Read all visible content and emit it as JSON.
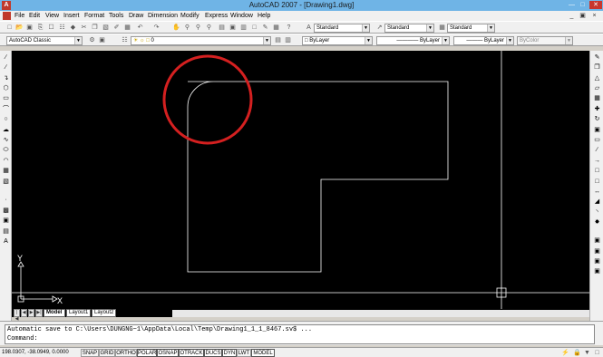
{
  "window": {
    "title": "AutoCAD 2007 - [Drawing1.dwg]",
    "app_icon": "autocad-logo-icon"
  },
  "menu": {
    "items": [
      "File",
      "Edit",
      "View",
      "Insert",
      "Format",
      "Tools",
      "Draw",
      "Dimension",
      "Modify",
      "Express",
      "Window",
      "Help"
    ]
  },
  "styles_toolbar": {
    "text_style": "Standard",
    "dim_style": "Standard",
    "table_style": "Standard"
  },
  "workspace_toolbar": {
    "workspace": "AutoCAD Classic",
    "layer": "0"
  },
  "properties_toolbar": {
    "color": "ByLayer",
    "linetype": "ByLayer",
    "lineweight": "ByLayer",
    "plot_style": "ByColor"
  },
  "drawing": {
    "shape_color": "#ffffff",
    "highlight_color": "#d42020",
    "background": "#000000",
    "ucs_x": "X",
    "ucs_y": "Y"
  },
  "layout_tabs": [
    "Model",
    "Layout1",
    "Layout2"
  ],
  "command": {
    "history": "Automatic save to C:\\Users\\DUNGNG~1\\AppData\\Local\\Temp\\Drawing1_1_1_8467.sv$ ...",
    "prompt": "Command:"
  },
  "status": {
    "coordinates": "198.0307, -38.0949, 0.0000",
    "toggles": [
      "SNAP",
      "GRID",
      "ORTHO",
      "POLAR",
      "OSNAP",
      "OTRACK",
      "DUCS",
      "DYN",
      "LWT",
      "MODEL"
    ]
  }
}
